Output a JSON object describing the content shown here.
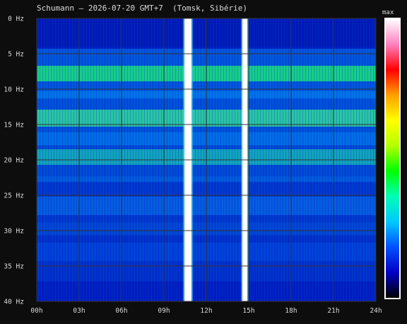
{
  "title": "Schumann — 2026-07-20 GMT+7  (Tomsk, Sibérie)",
  "colorbar_label": "max",
  "chart_data": {
    "type": "heatmap",
    "title": "Schumann — 2026-07-20 GMT+7  (Tomsk, Sibérie)",
    "xlabel": "",
    "ylabel": "",
    "x_ticks": [
      "00h",
      "03h",
      "06h",
      "09h",
      "12h",
      "15h",
      "18h",
      "21h",
      "24h"
    ],
    "y_ticks": [
      "0 Hz",
      "5 Hz",
      "10 Hz",
      "15 Hz",
      "20 Hz",
      "25 Hz",
      "30 Hz",
      "35 Hz",
      "40 Hz"
    ],
    "xlim": [
      0,
      24
    ],
    "ylim": [
      0,
      40
    ],
    "x_unit": "hours",
    "y_unit": "Hz",
    "grid": true,
    "colorbar": "right",
    "colorbar_max_label": "max",
    "resonance_bands_hz": [
      7.8,
      14.1,
      19.6,
      26.5,
      33
    ],
    "interference_bands_hours": [
      [
        10.45,
        10.95
      ],
      [
        14.55,
        14.9
      ]
    ],
    "background_color": "#000000",
    "colormap": [
      "#000000",
      "#0000c8",
      "#0050ff",
      "#00c8ff",
      "#00ffb4",
      "#00ff00",
      "#b4ff00",
      "#ffff00",
      "#ffa000",
      "#ff0000",
      "#ff80c0",
      "#ffffff"
    ]
  }
}
